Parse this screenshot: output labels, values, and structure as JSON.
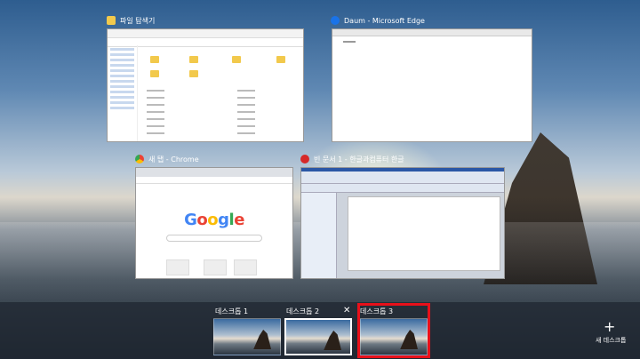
{
  "windows": {
    "explorer": {
      "title": "파일 탐색기"
    },
    "edge": {
      "title": "Daum - Microsoft Edge"
    },
    "chrome": {
      "title": "새 탭 - Chrome",
      "logo": "Google"
    },
    "hwp": {
      "title": "빈 문서 1 - 한글과컴퓨터 한글"
    }
  },
  "desktops": {
    "items": [
      {
        "label": "데스크톱 1"
      },
      {
        "label": "데스크톱 2",
        "close": "✕"
      },
      {
        "label": "데스크톱 3"
      }
    ],
    "new_label": "새 데스크톱",
    "new_icon": "+"
  },
  "colors": {
    "highlight": "#e8101a",
    "explorer_icon": "#f2c94c",
    "edge_icon": "#1a73e8",
    "chrome_icon": "#4285f4",
    "hwp_icon": "#d62828"
  }
}
